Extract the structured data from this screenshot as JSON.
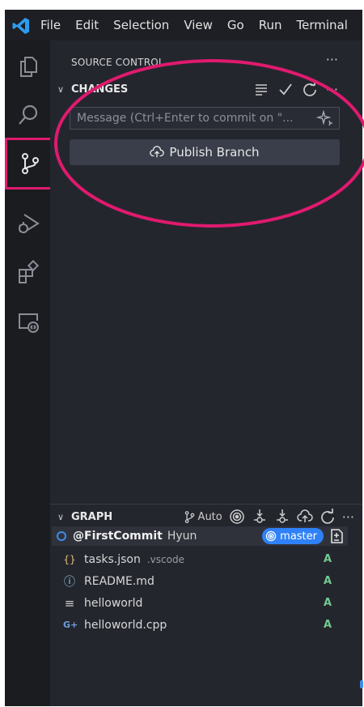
{
  "menu": [
    "File",
    "Edit",
    "Selection",
    "View",
    "Go",
    "Run",
    "Terminal"
  ],
  "panel": {
    "title": "SOURCE CONTROL",
    "more": "···"
  },
  "changes": {
    "chevron": "∨",
    "title": "CHANGES",
    "more": "···",
    "message_placeholder": "Message (Ctrl+Enter to commit on \"...",
    "publish_label": "Publish Branch"
  },
  "graph": {
    "chevron": "∨",
    "title": "GRAPH",
    "auto_label": "Auto",
    "more": "···",
    "commit": {
      "message": "@FirstCommit",
      "author": "Hyun",
      "branch": "master"
    },
    "files": [
      {
        "icon": "{}",
        "icon_color": "#e5c07b",
        "name": "tasks.json",
        "dir": ".vscode",
        "status": "A"
      },
      {
        "icon": "ⓘ",
        "icon_color": "#9cdcfe",
        "name": "README.md",
        "dir": "",
        "status": "A"
      },
      {
        "icon": "≡",
        "icon_color": "#cccccc",
        "name": "helloworld",
        "dir": "",
        "status": "A"
      },
      {
        "icon": "G+",
        "icon_color": "#6ca0dc",
        "name": "helloworld.cpp",
        "dir": "",
        "status": "A"
      }
    ]
  },
  "colors": {
    "accent": "#2f81f7",
    "annotation": "#e01a6e",
    "added_status": "#73c991"
  }
}
